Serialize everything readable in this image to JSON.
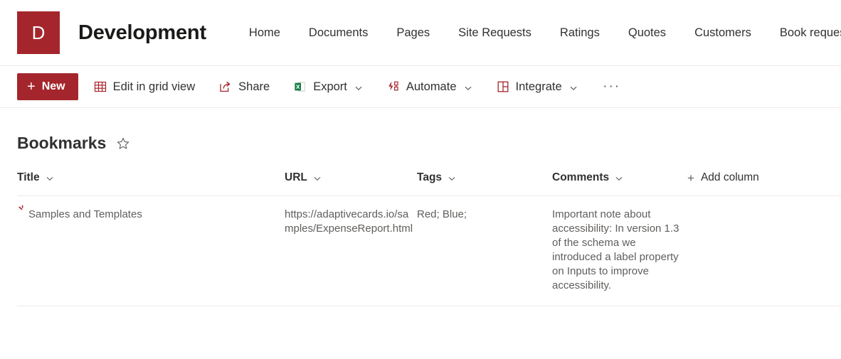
{
  "site": {
    "logo_letter": "D",
    "logo_color": "#A4262C",
    "title": "Development",
    "nav_items": [
      {
        "label": "Home"
      },
      {
        "label": "Documents"
      },
      {
        "label": "Pages"
      },
      {
        "label": "Site Requests"
      },
      {
        "label": "Ratings"
      },
      {
        "label": "Quotes"
      },
      {
        "label": "Customers"
      },
      {
        "label": "Book requests"
      }
    ]
  },
  "command_bar": {
    "new_label": "New",
    "new_plus": "+",
    "items": [
      {
        "label": "Edit in grid view",
        "icon": "grid-view-icon",
        "has_chevron": false
      },
      {
        "label": "Share",
        "icon": "share-icon",
        "has_chevron": false
      },
      {
        "label": "Export",
        "icon": "excel-export-icon",
        "has_chevron": true
      },
      {
        "label": "Automate",
        "icon": "automate-icon",
        "has_chevron": true
      },
      {
        "label": "Integrate",
        "icon": "integrate-icon",
        "has_chevron": true
      }
    ],
    "overflow_label": "···"
  },
  "list": {
    "title": "Bookmarks",
    "favorite_icon": "star-outline-icon",
    "columns": [
      {
        "label": "Title",
        "sortable": true
      },
      {
        "label": "URL",
        "sortable": true
      },
      {
        "label": "Tags",
        "sortable": true
      },
      {
        "label": "Comments",
        "sortable": true
      }
    ],
    "add_column_label": "Add column",
    "add_column_plus": "+",
    "rows": [
      {
        "title": "Samples and Templates",
        "status_icon": "loading-spinner-icon",
        "url": "https://adaptivecards.io/samples/ExpenseReport.html",
        "tags": "Red; Blue;",
        "comments": "Important note about accessibility: In version 1.3 of the schema we introduced a label property on Inputs to improve accessibility."
      }
    ]
  },
  "theme": {
    "accent": "#A4262C",
    "text_primary": "#323130",
    "text_secondary": "#605e5c",
    "border": "#edebe9"
  }
}
